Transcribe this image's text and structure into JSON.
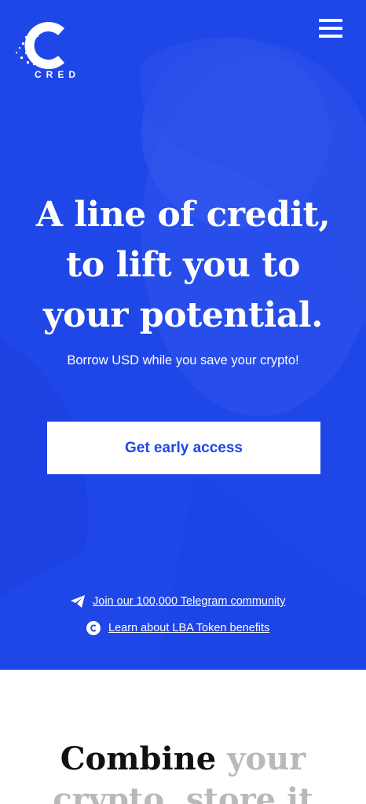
{
  "brand": {
    "name": "CRED"
  },
  "hero": {
    "headline_lines": [
      "A line of credit,",
      "to lift you to",
      "your potential."
    ],
    "subheadline": "Borrow USD while you save your crypto!",
    "cta_label": "Get early access",
    "links": [
      {
        "label": "Join our 100,000 Telegram community",
        "icon": "telegram-icon"
      },
      {
        "label": "Learn about LBA Token benefits",
        "icon": "cred-token-icon"
      }
    ]
  },
  "section2": {
    "heading_dark": "Combine",
    "heading_light_1": "your",
    "heading_light_2": "crypto, store it"
  },
  "colors": {
    "hero_bg": "#1f47e8",
    "cta_text": "#1f47e8",
    "heading_dark": "#111111",
    "heading_light": "#b9b9b9"
  }
}
